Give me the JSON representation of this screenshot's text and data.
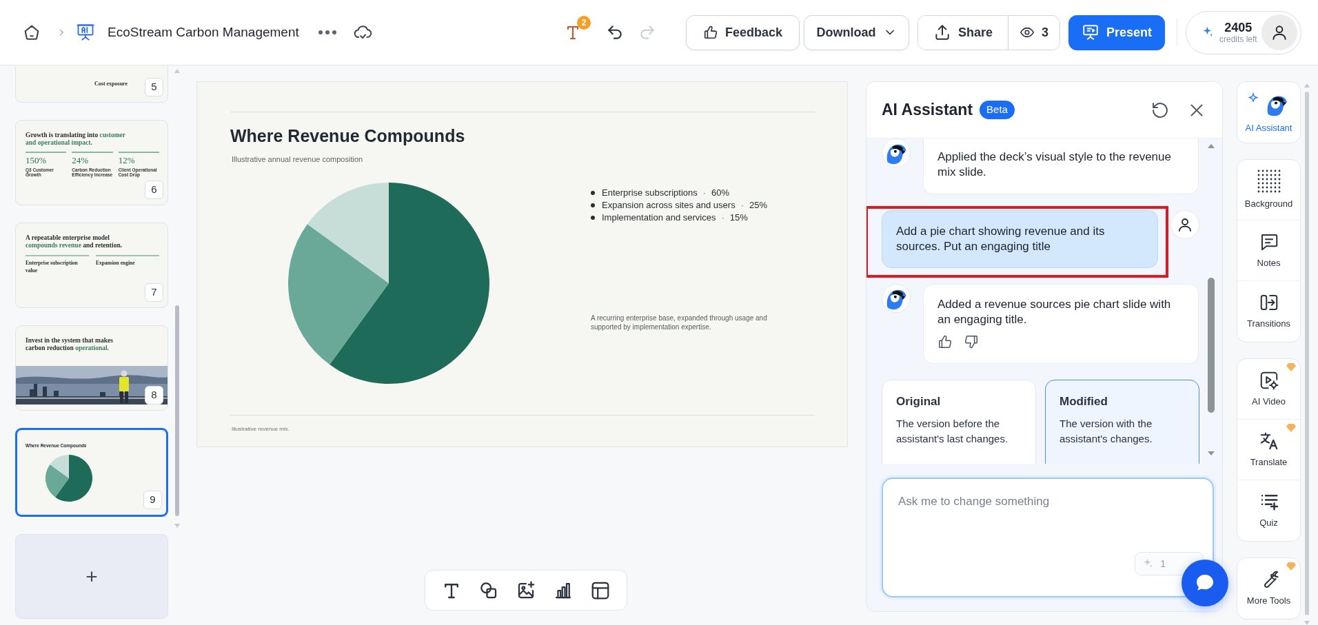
{
  "header": {
    "title": "EcoStream Carbon Management",
    "notification_count": "2",
    "redo_disabled": true,
    "buttons": [
      {
        "kind": "feedback",
        "label": "Feedback"
      },
      {
        "kind": "download",
        "label": "Download"
      },
      {
        "kind": "share",
        "label": "Share"
      },
      {
        "kind": "viewers",
        "label": "3"
      },
      {
        "kind": "present",
        "label": "Present"
      }
    ],
    "credits": {
      "value": "2405",
      "label": "credits left"
    }
  },
  "slides": [
    {
      "number": "5",
      "kind": "cut",
      "selected": false,
      "heading": "Cost exposure"
    },
    {
      "number": "6",
      "kind": "stats",
      "selected": false,
      "title": [
        {
          "text": "Growth is translating into ",
          "accent": false
        },
        {
          "text": "customer and operational impact.",
          "accent": true
        }
      ],
      "stats": [
        {
          "value": "150%",
          "label": "Q3 Customer Growth"
        },
        {
          "value": "24%",
          "label": "Carbon Reduction Efficiency Increase"
        },
        {
          "value": "12%",
          "label": "Client Operational Cost Drop"
        }
      ]
    },
    {
      "number": "7",
      "kind": "columns",
      "selected": false,
      "title": [
        {
          "text": "A repeatable enterprise model ",
          "accent": false
        },
        {
          "text": "compounds revenue",
          "accent": true
        },
        {
          "text": " and retention.",
          "accent": false
        }
      ],
      "columns": [
        "Enterprise subscription value",
        "Expansion engine"
      ]
    },
    {
      "number": "8",
      "selected": false,
      "title": [
        {
          "text": "Invest in the system that makes carbon reduction ",
          "accent": false
        },
        {
          "text": "operational.",
          "accent": true
        }
      ]
    },
    {
      "number": "9",
      "kind": "chart",
      "selected": true,
      "heading": "Where Revenue Compounds"
    }
  ],
  "add_slide": {
    "label": "+"
  },
  "canvas": {
    "title": "Where Revenue Compounds",
    "subtitle": "Illustrative annual revenue composition",
    "chart_data": {
      "type": "pie",
      "categories": [
        "Enterprise subscriptions",
        "Expansion across sites and users",
        "Implementation and services"
      ],
      "values": [
        60,
        25,
        15
      ],
      "colors": [
        "#1f6b5a",
        "#6aa998",
        "#c7ded8"
      ]
    },
    "legend_separator": "·",
    "legend_values": [
      "60%",
      "25%",
      "15%"
    ],
    "note": "A recurring enterprise base, expanded through usage and supported by implementation expertise.",
    "footer": "Illustrative revenue mix."
  },
  "assistant": {
    "title": "AI Assistant",
    "badge": "Beta",
    "messages": [
      {
        "kind": "assistant",
        "text": "Applied the deck’s visual style to the revenue mix slide.",
        "feedback": false,
        "highlighted": false
      },
      {
        "kind": "user",
        "text": "Add a pie chart showing revenue and its sources. Put an engaging title",
        "feedback": false,
        "highlighted": true
      },
      {
        "kind": "assistant",
        "text": "Added a revenue sources pie chart slide with an engaging title.",
        "feedback": true,
        "highlighted": false
      }
    ],
    "versions": [
      {
        "title": "Original",
        "description": "The version before the assistant's last changes.",
        "selected": false
      },
      {
        "title": "Modified",
        "description": "The version with the assistant's changes.",
        "selected": true
      }
    ],
    "input": {
      "placeholder": "Ask me to change something"
    },
    "credit_cost": "1"
  },
  "tool_groups": [
    {
      "items": [
        {
          "kind": "ai-assistant",
          "label": "AI Assistant",
          "selected": true,
          "premium": false
        }
      ]
    },
    {
      "items": [
        {
          "kind": "background",
          "label": "Background",
          "selected": false,
          "premium": false
        },
        {
          "kind": "notes",
          "label": "Notes",
          "selected": false,
          "premium": false
        },
        {
          "kind": "transitions",
          "label": "Transitions",
          "selected": false,
          "premium": false
        }
      ]
    },
    {
      "items": [
        {
          "kind": "ai-video",
          "label": "AI Video",
          "selected": false,
          "premium": true
        },
        {
          "kind": "translate",
          "label": "Translate",
          "selected": false,
          "premium": true
        },
        {
          "kind": "quiz",
          "label": "Quiz",
          "selected": false,
          "premium": false
        }
      ]
    },
    {
      "items": [
        {
          "kind": "more-tools",
          "label": "More Tools",
          "selected": false,
          "premium": true
        }
      ]
    }
  ]
}
